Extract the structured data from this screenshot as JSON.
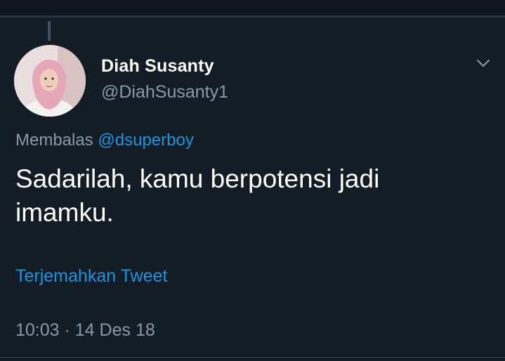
{
  "colors": {
    "background": "#141d26",
    "primary_text": "#ffffff",
    "secondary_text": "#8899a6",
    "link": "#1b95e0",
    "divider": "#253341"
  },
  "tweet": {
    "author": {
      "display_name": "Diah Susanty",
      "handle": "@DiahSusanty1",
      "avatar_icon": "profile-photo"
    },
    "menu_icon": "chevron-down-icon",
    "reply_to": {
      "prefix": "Membalas",
      "mention": "@dsuperboy"
    },
    "text": "Sadarilah, kamu berpotensi jadi imamku.",
    "translate_label": "Terjemahkan Tweet",
    "timestamp": {
      "time": "10:03",
      "separator": "·",
      "date": "14 Des 18"
    }
  }
}
